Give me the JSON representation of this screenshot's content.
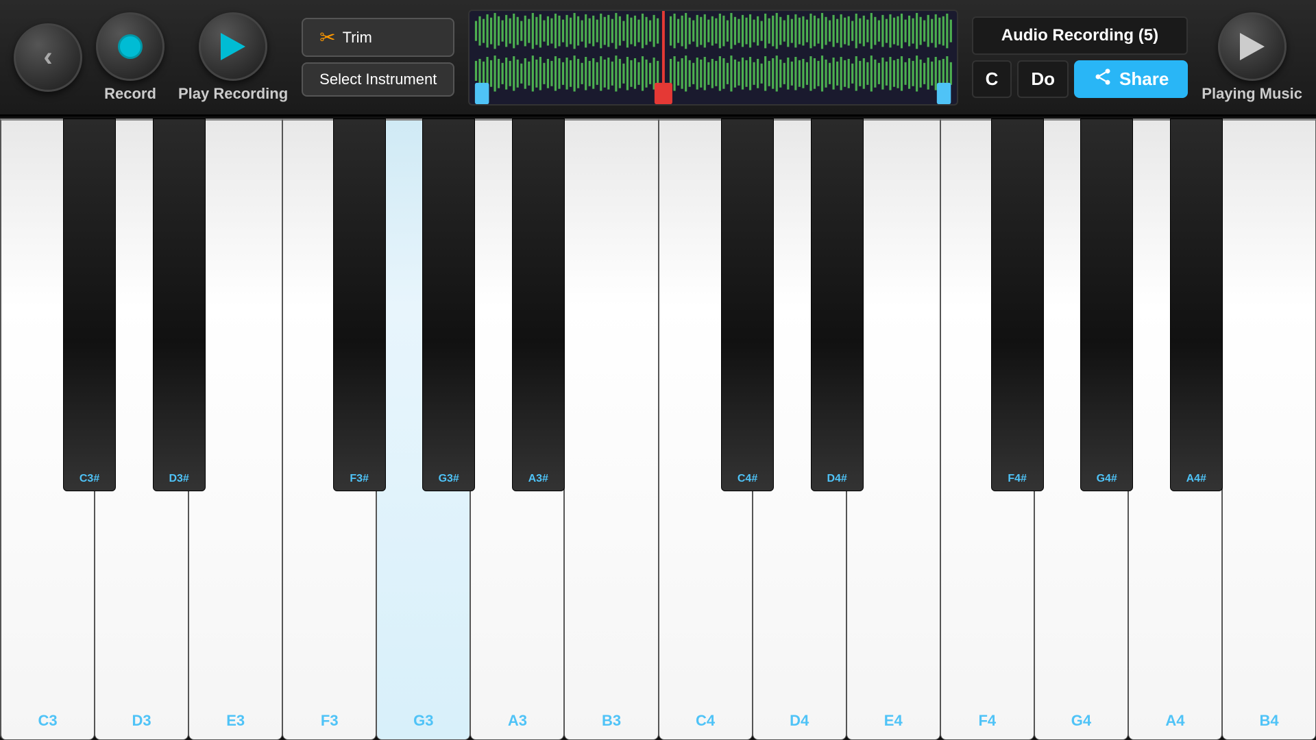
{
  "topBar": {
    "record": {
      "label": "Record"
    },
    "playRecording": {
      "label": "Play Recording"
    },
    "trim": {
      "label": "Trim"
    },
    "selectInstrument": {
      "label": "Select Instrument"
    },
    "audioRecording": {
      "title": "Audio Recording (5)",
      "noteC": "C",
      "noteDo": "Do",
      "share": "Share"
    },
    "playingMusic": {
      "label": "Playing Music"
    }
  },
  "piano": {
    "octave3": {
      "whiteKeys": [
        "C3",
        "D3",
        "E3",
        "F3",
        "G3",
        "A3",
        "B3"
      ],
      "blackKeys": [
        {
          "label": "C3#",
          "offset": 6.0
        },
        {
          "label": "D3#",
          "offset": 12.5
        },
        {
          "label": "F3#",
          "offset": 25.5
        },
        {
          "label": "G3#",
          "offset": 32.0
        },
        {
          "label": "A3#",
          "offset": 38.5
        }
      ]
    },
    "octave4": {
      "whiteKeys": [
        "C4",
        "D4",
        "E4",
        "F4",
        "G4",
        "A4",
        "B4"
      ],
      "blackKeys": [
        {
          "label": "C4#",
          "offset": 55.0
        },
        {
          "label": "D4#",
          "offset": 61.5
        },
        {
          "label": "F4#",
          "offset": 74.5
        },
        {
          "label": "G4#",
          "offset": 81.0
        },
        {
          "label": "A4#",
          "offset": 87.5
        }
      ]
    }
  }
}
